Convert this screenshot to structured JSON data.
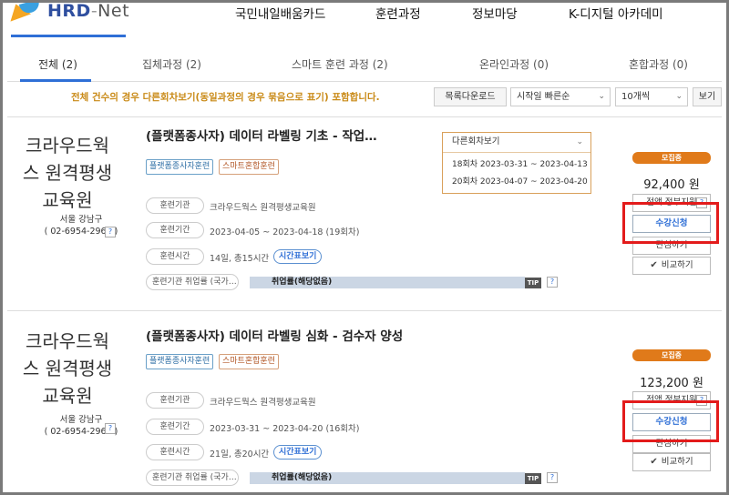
{
  "header": {
    "logo_text": "HRD",
    "logo_dash": "-",
    "logo_net": "Net",
    "nav": [
      "국민내일배움카드",
      "훈련과정",
      "정보마당",
      "K-디지털 아카데미"
    ]
  },
  "tabs": [
    {
      "label": "전체 (2)",
      "active": true
    },
    {
      "label": "집체과정 (2)",
      "active": false
    },
    {
      "label": "스마트 훈련 과정 (2)",
      "active": false
    },
    {
      "label": "온라인과정 (0)",
      "active": false
    },
    {
      "label": "혼합과정 (0)",
      "active": false
    }
  ],
  "notice": "전체 건수의 경우 다른회차보기(동일과정의 경우 묶음으로 표기) 포함합니다.",
  "controls": {
    "download": "목록다운로드",
    "sort": "시작일 빠른순",
    "page_size": "10개씩",
    "view": "보기"
  },
  "colors": {
    "accent_blue": "#2f6fd6",
    "status_orange": "#e07a1a",
    "notice_gold": "#c98a17",
    "highlight_red": "#e31b1b"
  },
  "courses": [
    {
      "org_name": "크라우드웍스 원격평생교육원",
      "org_lines": [
        "크라우드웍",
        "스 원격평생",
        "교육원"
      ],
      "addr_region": "서울 강남구",
      "addr_phone": "( 02-6954-2960 )",
      "title": "(플랫폼종사자) 데이터 라벨링 기초 - 작업…",
      "tags": [
        "플랫폼종사자훈련",
        "스마트혼합훈련"
      ],
      "org_label": "훈련기관",
      "org_value": "크라우드웍스 원격평생교육원",
      "period_label": "훈련기간",
      "period_value": "2023-04-05 ~ 2023-04-18 (19회차)",
      "time_label": "훈련시간",
      "time_value": "14일, 총15시간",
      "time_btn": "시간표보기",
      "emp_label": "훈련기관 취업률 (국가…",
      "emp_value": "취업률(해당없음)",
      "tip": "TIP",
      "other_rounds": {
        "label": "다른회차보기",
        "rows": [
          "18회차 2023-03-31 ~ 2023-04-13",
          "20회차 2023-04-07 ~ 2023-04-20"
        ]
      },
      "status": "모집중",
      "price": "92,400 원",
      "subsidy": "전액 정부지원",
      "apply": "수강신청",
      "interest": "관심하기",
      "compare": "비교하기"
    },
    {
      "org_name": "크라우드웍스 원격평생교육원",
      "org_lines": [
        "크라우드웍",
        "스 원격평생",
        "교육원"
      ],
      "addr_region": "서울 강남구",
      "addr_phone": "( 02-6954-2960 )",
      "title": "(플랫폼종사자) 데이터 라벨링 심화 - 검수자 양성",
      "tags": [
        "플랫폼종사자훈련",
        "스마트혼합훈련"
      ],
      "org_label": "훈련기관",
      "org_value": "크라우드웍스 원격평생교육원",
      "period_label": "훈련기간",
      "period_value": "2023-03-31 ~ 2023-04-20 (16회차)",
      "time_label": "훈련시간",
      "time_value": "21일, 총20시간",
      "time_btn": "시간표보기",
      "emp_label": "훈련기관 취업률 (국가…",
      "emp_value": "취업률(해당없음)",
      "tip": "TIP",
      "status": "모집중",
      "price": "123,200 원",
      "subsidy": "전액 정부지원",
      "apply": "수강신청",
      "interest": "관심하기",
      "compare": "비교하기"
    }
  ]
}
